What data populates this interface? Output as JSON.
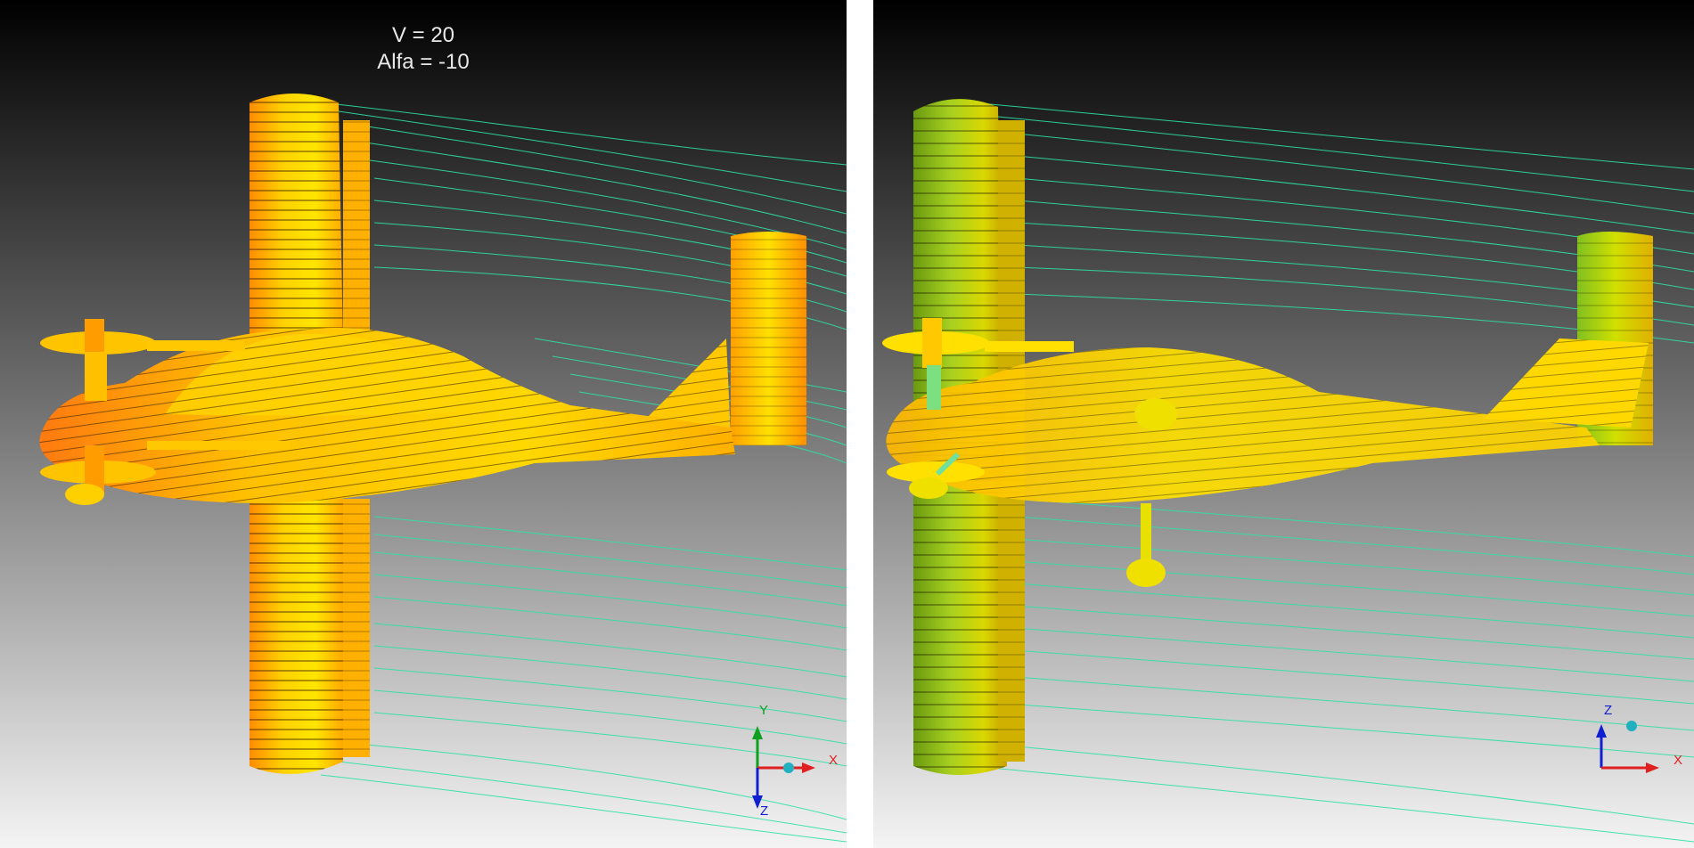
{
  "viewports": {
    "left": {
      "v_label": "V = 20",
      "alfa_label": "Alfa = -10",
      "axes": {
        "up": "Y",
        "right": "X",
        "down": "Z"
      }
    },
    "right": {
      "axes": {
        "up": "Z",
        "right": "X"
      }
    }
  },
  "colors": {
    "background_top": "#050505",
    "background_bottom": "#f2f2f2",
    "streamline": "#2fe0a8",
    "surface_orange": "#ff9a00",
    "surface_yellow": "#ffe400",
    "surface_green": "#8fd02a",
    "axis_x": "#e02020",
    "axis_y": "#10a020",
    "axis_z": "#1020d0"
  },
  "icons": [
    "airplane-model-icon",
    "coordinate-axes-icon"
  ]
}
